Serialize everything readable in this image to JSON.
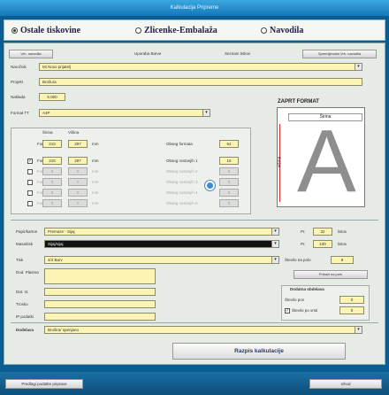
{
  "window": {
    "title": "Kalkulacija Pripreme"
  },
  "radios": [
    {
      "label": "Ostale tiskovine",
      "checked": true
    },
    {
      "label": "Zlicenke-Embalaža",
      "checked": false
    },
    {
      "label": "Navodila",
      "checked": false
    }
  ],
  "toolbar": {
    "left_button": "Vrh. navodila",
    "middle_button": "Uporaba Barve",
    "right_small": "Seznam tiskov",
    "right_button": "Spremljevalni Vrh. navodila"
  },
  "form": {
    "narocnik": {
      "label": "Naročnik",
      "value": "Mi Novo prijatelj"
    },
    "projekt": {
      "label": "Projekt",
      "value": "Brošura"
    },
    "naklada": {
      "label": "Naklada",
      "value": "5.000"
    },
    "format": {
      "label": "Format TT",
      "value": "A4P"
    }
  },
  "format_table": {
    "col_sirina": "Širina",
    "col_visina": "Višina",
    "rows": [
      {
        "label": "Format",
        "w": "210",
        "h": "297",
        "unit": "mm",
        "obseg_label": "Obseg formata",
        "obseg": "64",
        "checked": false,
        "enabled": true,
        "has_checkbox": false
      },
      {
        "label": "Format",
        "w": "210",
        "h": "297",
        "unit": "mm",
        "obseg_label": "Obseg notranjih 1",
        "obseg": "16",
        "checked": true,
        "enabled": true,
        "has_checkbox": true
      },
      {
        "label": "Format",
        "w": "0",
        "h": "0",
        "unit": "mm",
        "obseg_label": "Obseg notranjih 2",
        "obseg": "0",
        "checked": false,
        "enabled": false,
        "has_checkbox": true
      },
      {
        "label": "Format",
        "w": "0",
        "h": "0",
        "unit": "mm",
        "obseg_label": "Obseg notranjih 3",
        "obseg": "0",
        "checked": false,
        "enabled": false,
        "has_checkbox": true
      },
      {
        "label": "Format",
        "w": "0",
        "h": "0",
        "unit": "mm",
        "obseg_label": "Obseg notranjih 4",
        "obseg": "0",
        "checked": false,
        "enabled": false,
        "has_checkbox": true
      },
      {
        "label": "Format",
        "w": "0",
        "h": "0",
        "unit": "mm",
        "obseg_label": "Obseg notranjih 5",
        "obseg": "0",
        "checked": false,
        "enabled": false,
        "has_checkbox": true
      }
    ]
  },
  "preview": {
    "title": "ZAPRT FORMAT",
    "width_label": "Širina",
    "height_label": "višina",
    "letter": "A"
  },
  "materials": {
    "papir": {
      "label": "Papir/karton",
      "value": "Premaze - Sijaj"
    },
    "masa": {
      "label": "Masa/tisk",
      "value": "Sijaj/sijaj"
    },
    "tisk": {
      "label": "Tisk",
      "value": "4/4 Barv"
    },
    "dim1": {
      "label": "Pr.",
      "value": "32",
      "unit": "listov"
    },
    "dim2": {
      "label": "Pr.",
      "value": "100",
      "unit": "listov"
    },
    "pole_label": "Število na polo",
    "pole_value": "8",
    "pole_button": "Prikaži na polo",
    "left_fields": [
      "Dod. Plasma",
      "Dat. st.",
      "Trosko",
      "IP podatki"
    ],
    "group_title": "Dodatna obdelava",
    "group_row1_label": "Število pos",
    "group_row1_value": "0",
    "group_row2_label": "Število po vrsti",
    "group_row2_value": "0"
  },
  "dodelava": {
    "label": "Dodelava",
    "value": "Brošira/ spenjano"
  },
  "calculate_button": "Razpis kalkulacije",
  "footer": {
    "left_button": "Predlagi podatke priprave",
    "right_button": "Izhod"
  }
}
